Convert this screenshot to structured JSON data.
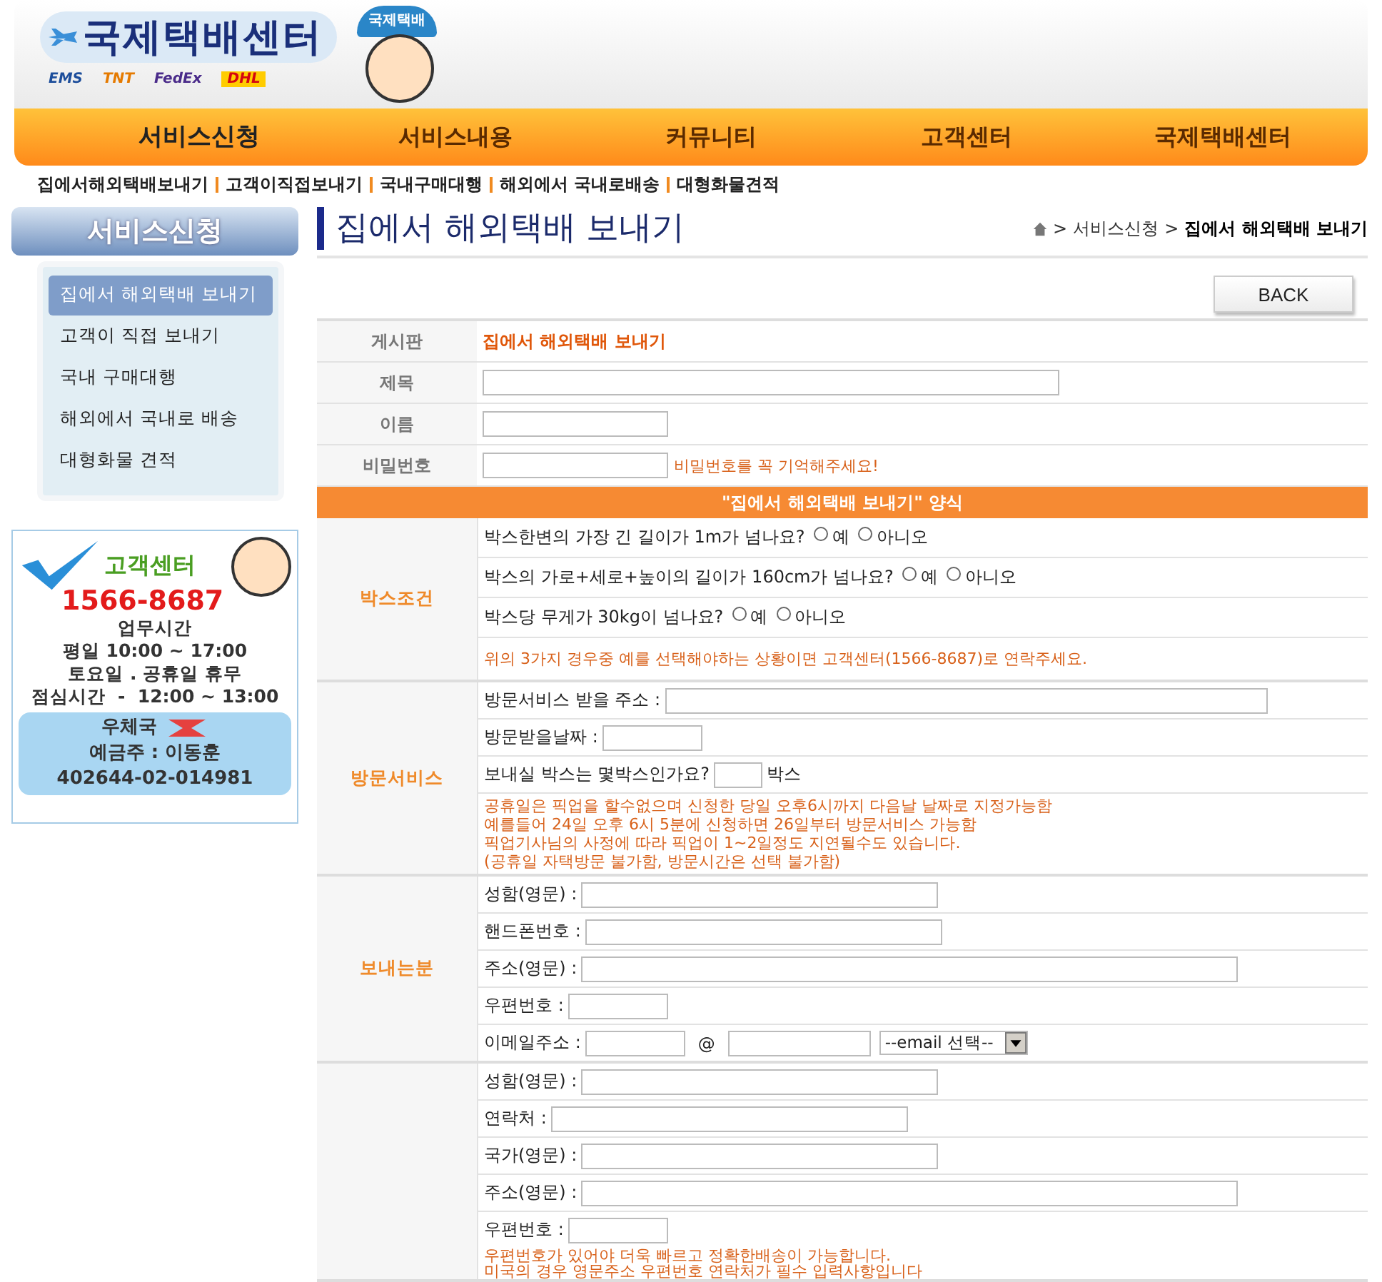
{
  "header": {
    "logo_text": "국제택배센터",
    "carriers": [
      "EMS",
      "TNT",
      "FedEx",
      "DHL"
    ],
    "mascot_cap": "국제택배"
  },
  "nav": [
    {
      "label": "서비스신청",
      "selected": true
    },
    {
      "label": "서비스내용",
      "selected": false
    },
    {
      "label": "커뮤니티",
      "selected": false
    },
    {
      "label": "고객센터",
      "selected": false
    },
    {
      "label": "국제택배센터",
      "selected": false
    }
  ],
  "subnav": [
    "집에서해외택배보내기",
    "고객이직접보내기",
    "국내구매대행",
    "해외에서 국내로배송",
    "대형화물견적"
  ],
  "sidebar": {
    "title": "서비스신청",
    "items": [
      {
        "label": "집에서 해외택배 보내기",
        "selected": true
      },
      {
        "label": "고객이 직접 보내기",
        "selected": false
      },
      {
        "label": "국내 구매대행",
        "selected": false
      },
      {
        "label": "해외에서 국내로 배송",
        "selected": false
      },
      {
        "label": "대형화물 견적",
        "selected": false
      }
    ]
  },
  "banner": {
    "title": "고객센터",
    "phone": "1566-8687",
    "hours_title": "업무시간",
    "hours": [
      "평일 10:00 ~ 17:00",
      "토요일 . 공휴일 휴무",
      "점심시간  -  12:00 ~ 13:00"
    ],
    "bank": "우체국",
    "holder": "예금주 : 이동훈",
    "account": "402644-02-014981"
  },
  "page_title": "집에서 해외택배 보내기",
  "breadcrumb": [
    "서비스신청",
    "집에서 해외택배 보내기"
  ],
  "breadcrumb_sep": ">",
  "back_button": "BACK",
  "info_rows": [
    {
      "label": "게시판",
      "kind": "text",
      "value": "집에서 해외택배 보내기"
    },
    {
      "label": "제목",
      "kind": "field"
    },
    {
      "label": "이름",
      "kind": "field"
    },
    {
      "label": "비밀번호",
      "kind": "field",
      "note": "비밀번호를 꼭 기억해주세요!"
    }
  ],
  "form_title": "\"집에서 해외택배 보내기\" 양식",
  "sections": [
    {
      "label": "박스조건",
      "rows": [
        {
          "kind": "radio",
          "text": "박스한변의 가장 긴 길이가 1m가 넘나요?",
          "options": [
            {
              "label": "예",
              "selected": false
            },
            {
              "label": "아니오",
              "selected": false
            }
          ]
        },
        {
          "kind": "radio",
          "text": "박스의 가로+세로+높이의 길이가 160cm가 넘나요?",
          "options": [
            {
              "label": "예",
              "selected": false
            },
            {
              "label": "아니오",
              "selected": false
            }
          ]
        },
        {
          "kind": "radio",
          "text": "박스당 무게가 30kg이 넘나요?",
          "options": [
            {
              "label": "예",
              "selected": false
            },
            {
              "label": "아니오",
              "selected": false
            }
          ]
        },
        {
          "kind": "note",
          "lines": [
            "위의 3가지 경우중 예를 선택해야하는 상황이면 고객센터(1566-8687)로 연락주세요."
          ]
        }
      ]
    },
    {
      "label": "방문서비스",
      "rows": [
        {
          "kind": "field",
          "text": "방문서비스 받을 주소 :"
        },
        {
          "kind": "field",
          "text": "방문받을날짜 :"
        },
        {
          "kind": "field",
          "text": "보내실 박스는 몇박스인가요?",
          "suffix": "박스"
        },
        {
          "kind": "note",
          "lines": [
            "공휴일은 픽업을 할수없으며 신청한 당일 오후6시까지 다음날 날짜로 지정가능함",
            "예를들어 24일 오후 6시 5분에 신청하면 26일부터 방문서비스 가능함",
            "픽업기사님의 사정에 따라 픽업이 1~2일정도 지연될수도 있습니다.",
            "(공휴일 자택방문 불가함, 방문시간은 선택 불가함)"
          ]
        }
      ]
    },
    {
      "label": "보내는분",
      "rows": [
        {
          "kind": "field",
          "text": "성함(영문) :"
        },
        {
          "kind": "field",
          "text": "핸드폰번호 :"
        },
        {
          "kind": "field",
          "text": "주소(영문) :"
        },
        {
          "kind": "field",
          "text": "우편번호 :"
        },
        {
          "kind": "email",
          "text": "이메일주소 :",
          "at": "@",
          "select": "--email 선택--"
        }
      ]
    },
    {
      "rows": [
        {
          "kind": "field",
          "text": "성함(영문) :"
        },
        {
          "kind": "field",
          "text": "연락처 :"
        },
        {
          "kind": "field",
          "text": "국가(영문) :"
        },
        {
          "kind": "field",
          "text": "주소(영문) :"
        },
        {
          "kind": "field",
          "text": "우편번호 :",
          "notes": [
            "우편번호가 있어야 더욱 빠르고 정확한배송이 가능합니다.",
            "미국의 경우 영문주소 우편번호 연락처가 필수 입력사항입니다"
          ]
        }
      ]
    }
  ]
}
